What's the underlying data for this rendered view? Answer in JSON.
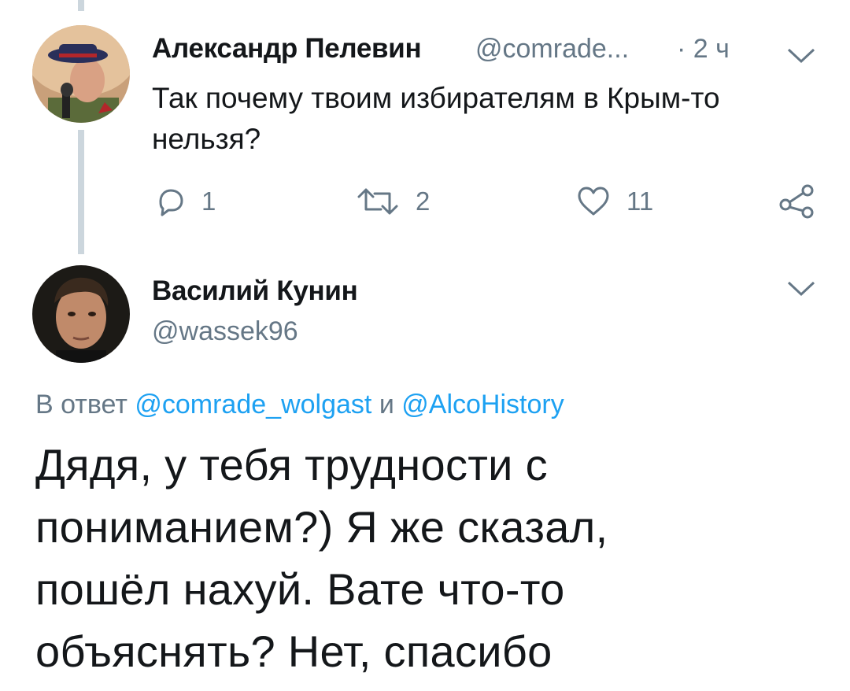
{
  "tweet1": {
    "author_name": "Александр Пелевин",
    "handle": "@comrade...",
    "time": "· 2 ч",
    "text": "Так почему твоим избирателям в Крым-то нельзя?",
    "reply_count": "1",
    "retweet_count": "2",
    "like_count": "11"
  },
  "tweet2": {
    "author_name": "Василий Кунин",
    "handle": "@wassek96",
    "reply_prefix": "В ответ",
    "mention1": "@comrade_wolgast",
    "and_word": "и",
    "mention2": "@AlcoHistory",
    "text": "Дядя, у тебя трудности с пониманием?) Я же сказал, пошёл нахуй. Вате что-то объяснять? Нет, спасибо"
  },
  "colors": {
    "text": "#14171a",
    "secondary": "#657786",
    "link": "#1da1f2",
    "thread_line": "#ccd6dd"
  },
  "icons": [
    "reply-icon",
    "retweet-icon",
    "like-icon",
    "share-icon",
    "chevron-down-icon"
  ]
}
